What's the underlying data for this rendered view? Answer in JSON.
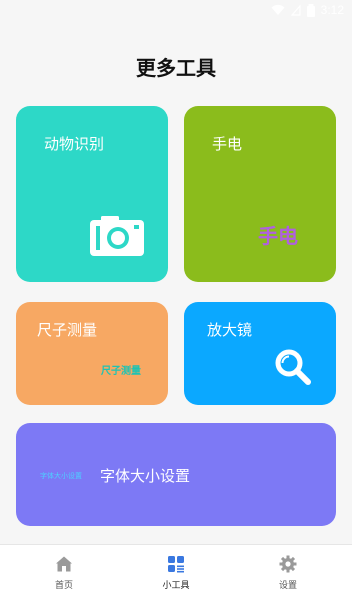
{
  "status_bar": {
    "time": "3:12"
  },
  "page": {
    "title": "更多工具"
  },
  "cards": [
    {
      "id": "animal",
      "label": "动物识别",
      "color": "#2dd8c7",
      "icon": "camera-icon"
    },
    {
      "id": "flashlight",
      "label": "手电",
      "sub_label": "手电",
      "color": "#8bbc1c",
      "sub_color": "#b05fe0"
    },
    {
      "id": "ruler",
      "label": "尺子测量",
      "sub_label": "尺子测量",
      "color": "#f7a863",
      "sub_color": "#1fc3b3"
    },
    {
      "id": "magnifier",
      "label": "放大镜",
      "color": "#0ba8ff",
      "icon": "magnifier-icon"
    },
    {
      "id": "fontsize",
      "label": "字体大小设置",
      "sub_label": "字体大小设置",
      "color": "#7d79f5",
      "sub_color": "#4dd0ff"
    }
  ],
  "bottom_nav": [
    {
      "label": "首页",
      "icon": "home-icon",
      "active": false
    },
    {
      "label": "小工具",
      "icon": "tools-grid-icon",
      "active": true,
      "active_color": "#3a78e0"
    },
    {
      "label": "设置",
      "icon": "gear-icon",
      "active": false
    }
  ]
}
